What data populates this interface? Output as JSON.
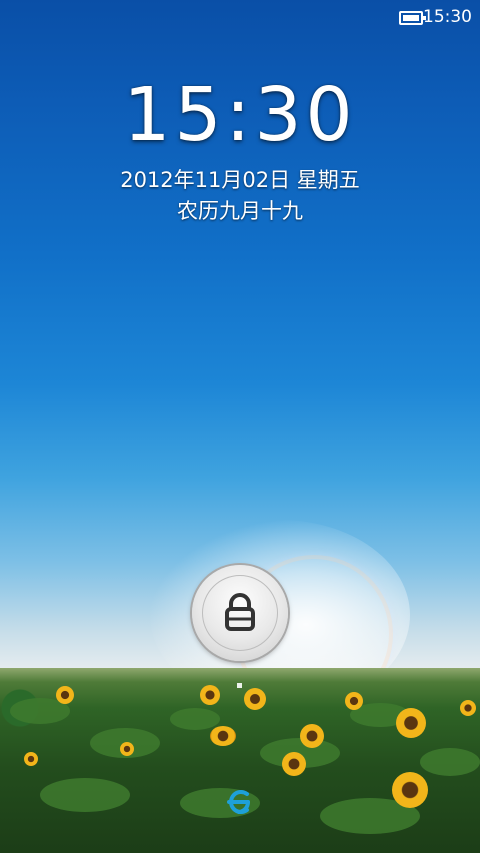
{
  "status_bar": {
    "time": "15:30",
    "battery_icon": "battery-full-icon"
  },
  "lockscreen": {
    "clock": "15:30",
    "date": "2012年11月02日 星期五",
    "lunar_date": "农历九月十九"
  },
  "unlock": {
    "icon": "lock-icon"
  },
  "bottom": {
    "icon": "unlock-target-icon"
  },
  "colors": {
    "sky_top": "#0a4fa7",
    "sky_mid": "#1d86d6",
    "horizon": "#e9eef0",
    "field": "#2f6426",
    "accent_logo": "#1ea0d8"
  }
}
